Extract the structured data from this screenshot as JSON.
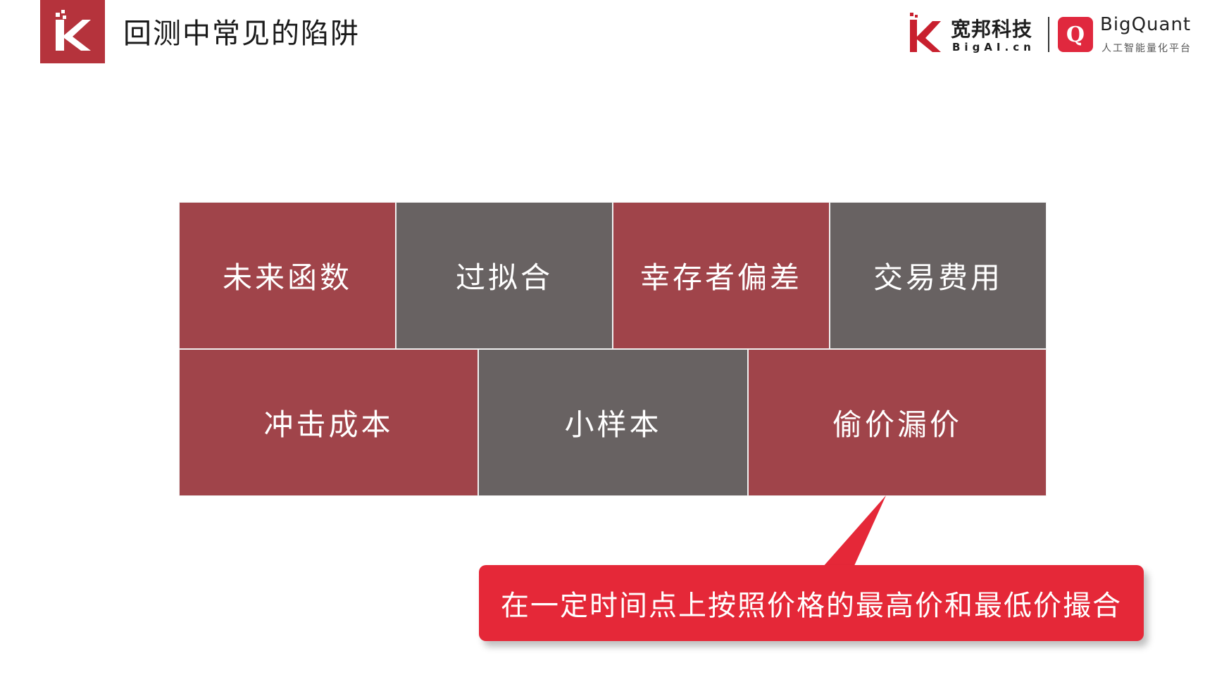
{
  "header": {
    "title": "回测中常见的陷阱"
  },
  "brand": {
    "cn_name": "宽邦科技",
    "cn_sub": "BigAI.cn",
    "bq_badge": "Q",
    "bq_name": "BigQuant",
    "bq_sub": "人工智能量化平台"
  },
  "pitfalls": {
    "row1": [
      "未来函数",
      "过拟合",
      "幸存者偏差",
      "交易费用"
    ],
    "row2": [
      "冲击成本",
      "小样本",
      "偷价漏价"
    ]
  },
  "callout": {
    "text": "在一定时间点上按照价格的最高价和最低价撮合"
  },
  "colors": {
    "logo": "#b5333c",
    "red_cell": "#a0444a",
    "gray_cell": "#686262",
    "callout": "#e52838"
  },
  "icons": {
    "logo": "k-logo-icon",
    "brand_logo": "k-brand-icon"
  }
}
